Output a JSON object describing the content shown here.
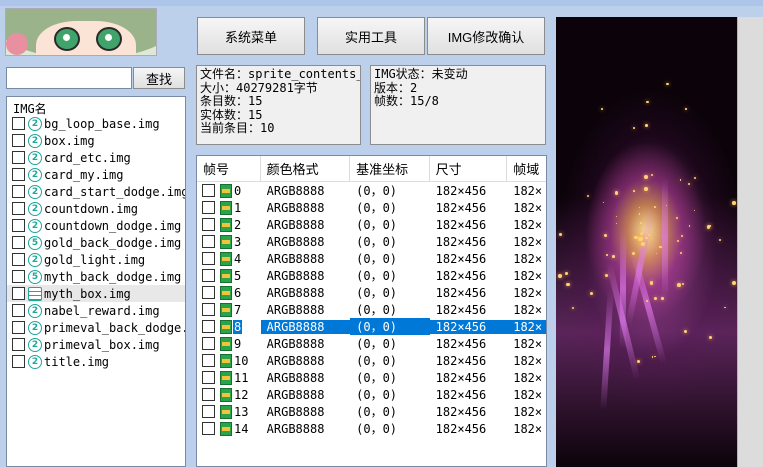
{
  "search": {
    "value": "",
    "button_label": "查找"
  },
  "toolbar": {
    "system_menu_label": "系统菜单",
    "tools_label": "实用工具",
    "img_confirm_label": "IMG修改确认"
  },
  "img_list": {
    "header": "IMG名",
    "items": [
      {
        "icon": "2",
        "name": "bg_loop_base.img"
      },
      {
        "icon": "2",
        "name": "box.img"
      },
      {
        "icon": "2",
        "name": "card_etc.img"
      },
      {
        "icon": "2",
        "name": "card_my.img"
      },
      {
        "icon": "2",
        "name": "card_start_dodge.img"
      },
      {
        "icon": "2",
        "name": "countdown.img"
      },
      {
        "icon": "2",
        "name": "countdown_dodge.img"
      },
      {
        "icon": "5",
        "name": "gold_back_dodge.img"
      },
      {
        "icon": "2",
        "name": "gold_light.img"
      },
      {
        "icon": "5",
        "name": "myth_back_dodge.img"
      },
      {
        "icon": "grid",
        "name": "myth_box.img"
      },
      {
        "icon": "2",
        "name": "nabel_reward.img"
      },
      {
        "icon": "2",
        "name": "primeval_back_dodge."
      },
      {
        "icon": "2",
        "name": "primeval_box.img"
      },
      {
        "icon": "2",
        "name": "title.img"
      }
    ]
  },
  "file_info": {
    "lines": [
      "文件名：sprite_contents_",
      "大小：40279281字节",
      "条目数：15",
      "实体数：15",
      "当前条目：10"
    ]
  },
  "img_info": {
    "lines": [
      "IMG状态：未变动",
      "版本：2",
      "帧数：15/8"
    ]
  },
  "frame_table": {
    "columns": [
      "帧号",
      "颜色格式",
      "基准坐标",
      "尺寸",
      "帧域"
    ],
    "selected_index": 8,
    "rows": [
      {
        "id": "0",
        "format": "ARGB8888",
        "coord": "(0，0)",
        "size": "182×456",
        "domain": "182×"
      },
      {
        "id": "1",
        "format": "ARGB8888",
        "coord": "(0，0)",
        "size": "182×456",
        "domain": "182×"
      },
      {
        "id": "2",
        "format": "ARGB8888",
        "coord": "(0，0)",
        "size": "182×456",
        "domain": "182×"
      },
      {
        "id": "3",
        "format": "ARGB8888",
        "coord": "(0，0)",
        "size": "182×456",
        "domain": "182×"
      },
      {
        "id": "4",
        "format": "ARGB8888",
        "coord": "(0，0)",
        "size": "182×456",
        "domain": "182×"
      },
      {
        "id": "5",
        "format": "ARGB8888",
        "coord": "(0，0)",
        "size": "182×456",
        "domain": "182×"
      },
      {
        "id": "6",
        "format": "ARGB8888",
        "coord": "(0，0)",
        "size": "182×456",
        "domain": "182×"
      },
      {
        "id": "7",
        "format": "ARGB8888",
        "coord": "(0，0)",
        "size": "182×456",
        "domain": "182×"
      },
      {
        "id": "8",
        "format": "ARGB8888",
        "coord": "(0，0)",
        "size": "182×456",
        "domain": "182×"
      },
      {
        "id": "9",
        "format": "ARGB8888",
        "coord": "(0，0)",
        "size": "182×456",
        "domain": "182×"
      },
      {
        "id": "10",
        "format": "ARGB8888",
        "coord": "(0，0)",
        "size": "182×456",
        "domain": "182×"
      },
      {
        "id": "11",
        "format": "ARGB8888",
        "coord": "(0，0)",
        "size": "182×456",
        "domain": "182×"
      },
      {
        "id": "12",
        "format": "ARGB8888",
        "coord": "(0，0)",
        "size": "182×456",
        "domain": "182×"
      },
      {
        "id": "13",
        "format": "ARGB8888",
        "coord": "(0，0)",
        "size": "182×456",
        "domain": "182×"
      },
      {
        "id": "14",
        "format": "ARGB8888",
        "coord": "(0，0)",
        "size": "182×456",
        "domain": "182×"
      }
    ]
  },
  "colors": {
    "background": "#bcd0ec",
    "selection": "#0078d7",
    "version_icon": "#1ea79a",
    "frame_icon": "#2aa34a"
  }
}
